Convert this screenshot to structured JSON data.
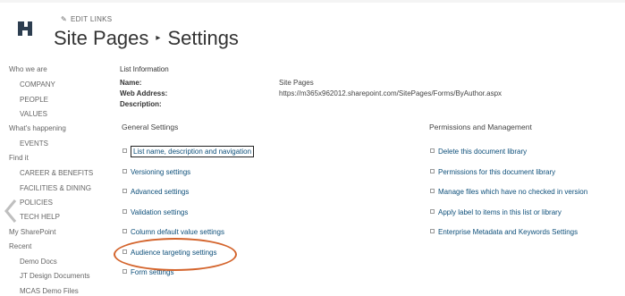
{
  "header": {
    "edit_links": "EDIT LINKS",
    "breadcrumb_parent": "Site Pages",
    "breadcrumb_current": "Settings"
  },
  "quicklaunch": {
    "items": [
      {
        "label": "Who we are",
        "level": 1
      },
      {
        "label": "COMPANY",
        "level": 2
      },
      {
        "label": "PEOPLE",
        "level": 2
      },
      {
        "label": "VALUES",
        "level": 2
      },
      {
        "label": "What's happening",
        "level": 1
      },
      {
        "label": "EVENTS",
        "level": 2
      },
      {
        "label": "Find it",
        "level": 1
      },
      {
        "label": "CAREER & BENEFITS",
        "level": 2
      },
      {
        "label": "FACILITIES & DINING",
        "level": 2
      },
      {
        "label": "POLICIES",
        "level": 2
      },
      {
        "label": "TECH HELP",
        "level": 2
      },
      {
        "label": "My SharePoint",
        "level": 1
      },
      {
        "label": "Recent",
        "level": 1
      },
      {
        "label": "Demo Docs",
        "level": 2
      },
      {
        "label": "JT Design Documents",
        "level": 2
      },
      {
        "label": "MCAS Demo Files",
        "level": 2
      }
    ]
  },
  "list_info": {
    "heading": "List Information",
    "name_label": "Name:",
    "name_value": "Site Pages",
    "address_label": "Web Address:",
    "address_value": "https://m365x962012.sharepoint.com/SitePages/Forms/ByAuthor.aspx",
    "description_label": "Description:"
  },
  "general_settings": {
    "heading": "General Settings",
    "items": [
      "List name, description and navigation",
      "Versioning settings",
      "Advanced settings",
      "Validation settings",
      "Column default value settings",
      "Audience targeting settings",
      "Form settings"
    ]
  },
  "permissions": {
    "heading": "Permissions and Management",
    "items": [
      "Delete this document library",
      "Permissions for this document library",
      "Manage files which have no checked in version",
      "Apply label to items in this list or library",
      "Enterprise Metadata and Keywords Settings"
    ]
  },
  "colors": {
    "link": "#0d4f7a",
    "annotation_ring": "#d4642c",
    "logo": "#2d3e50"
  },
  "icons": {
    "logo": "h-logo-icon",
    "edit": "pencil-icon",
    "breadcrumb_separator": "triangle-right-icon",
    "back": "chevron-left-icon"
  }
}
